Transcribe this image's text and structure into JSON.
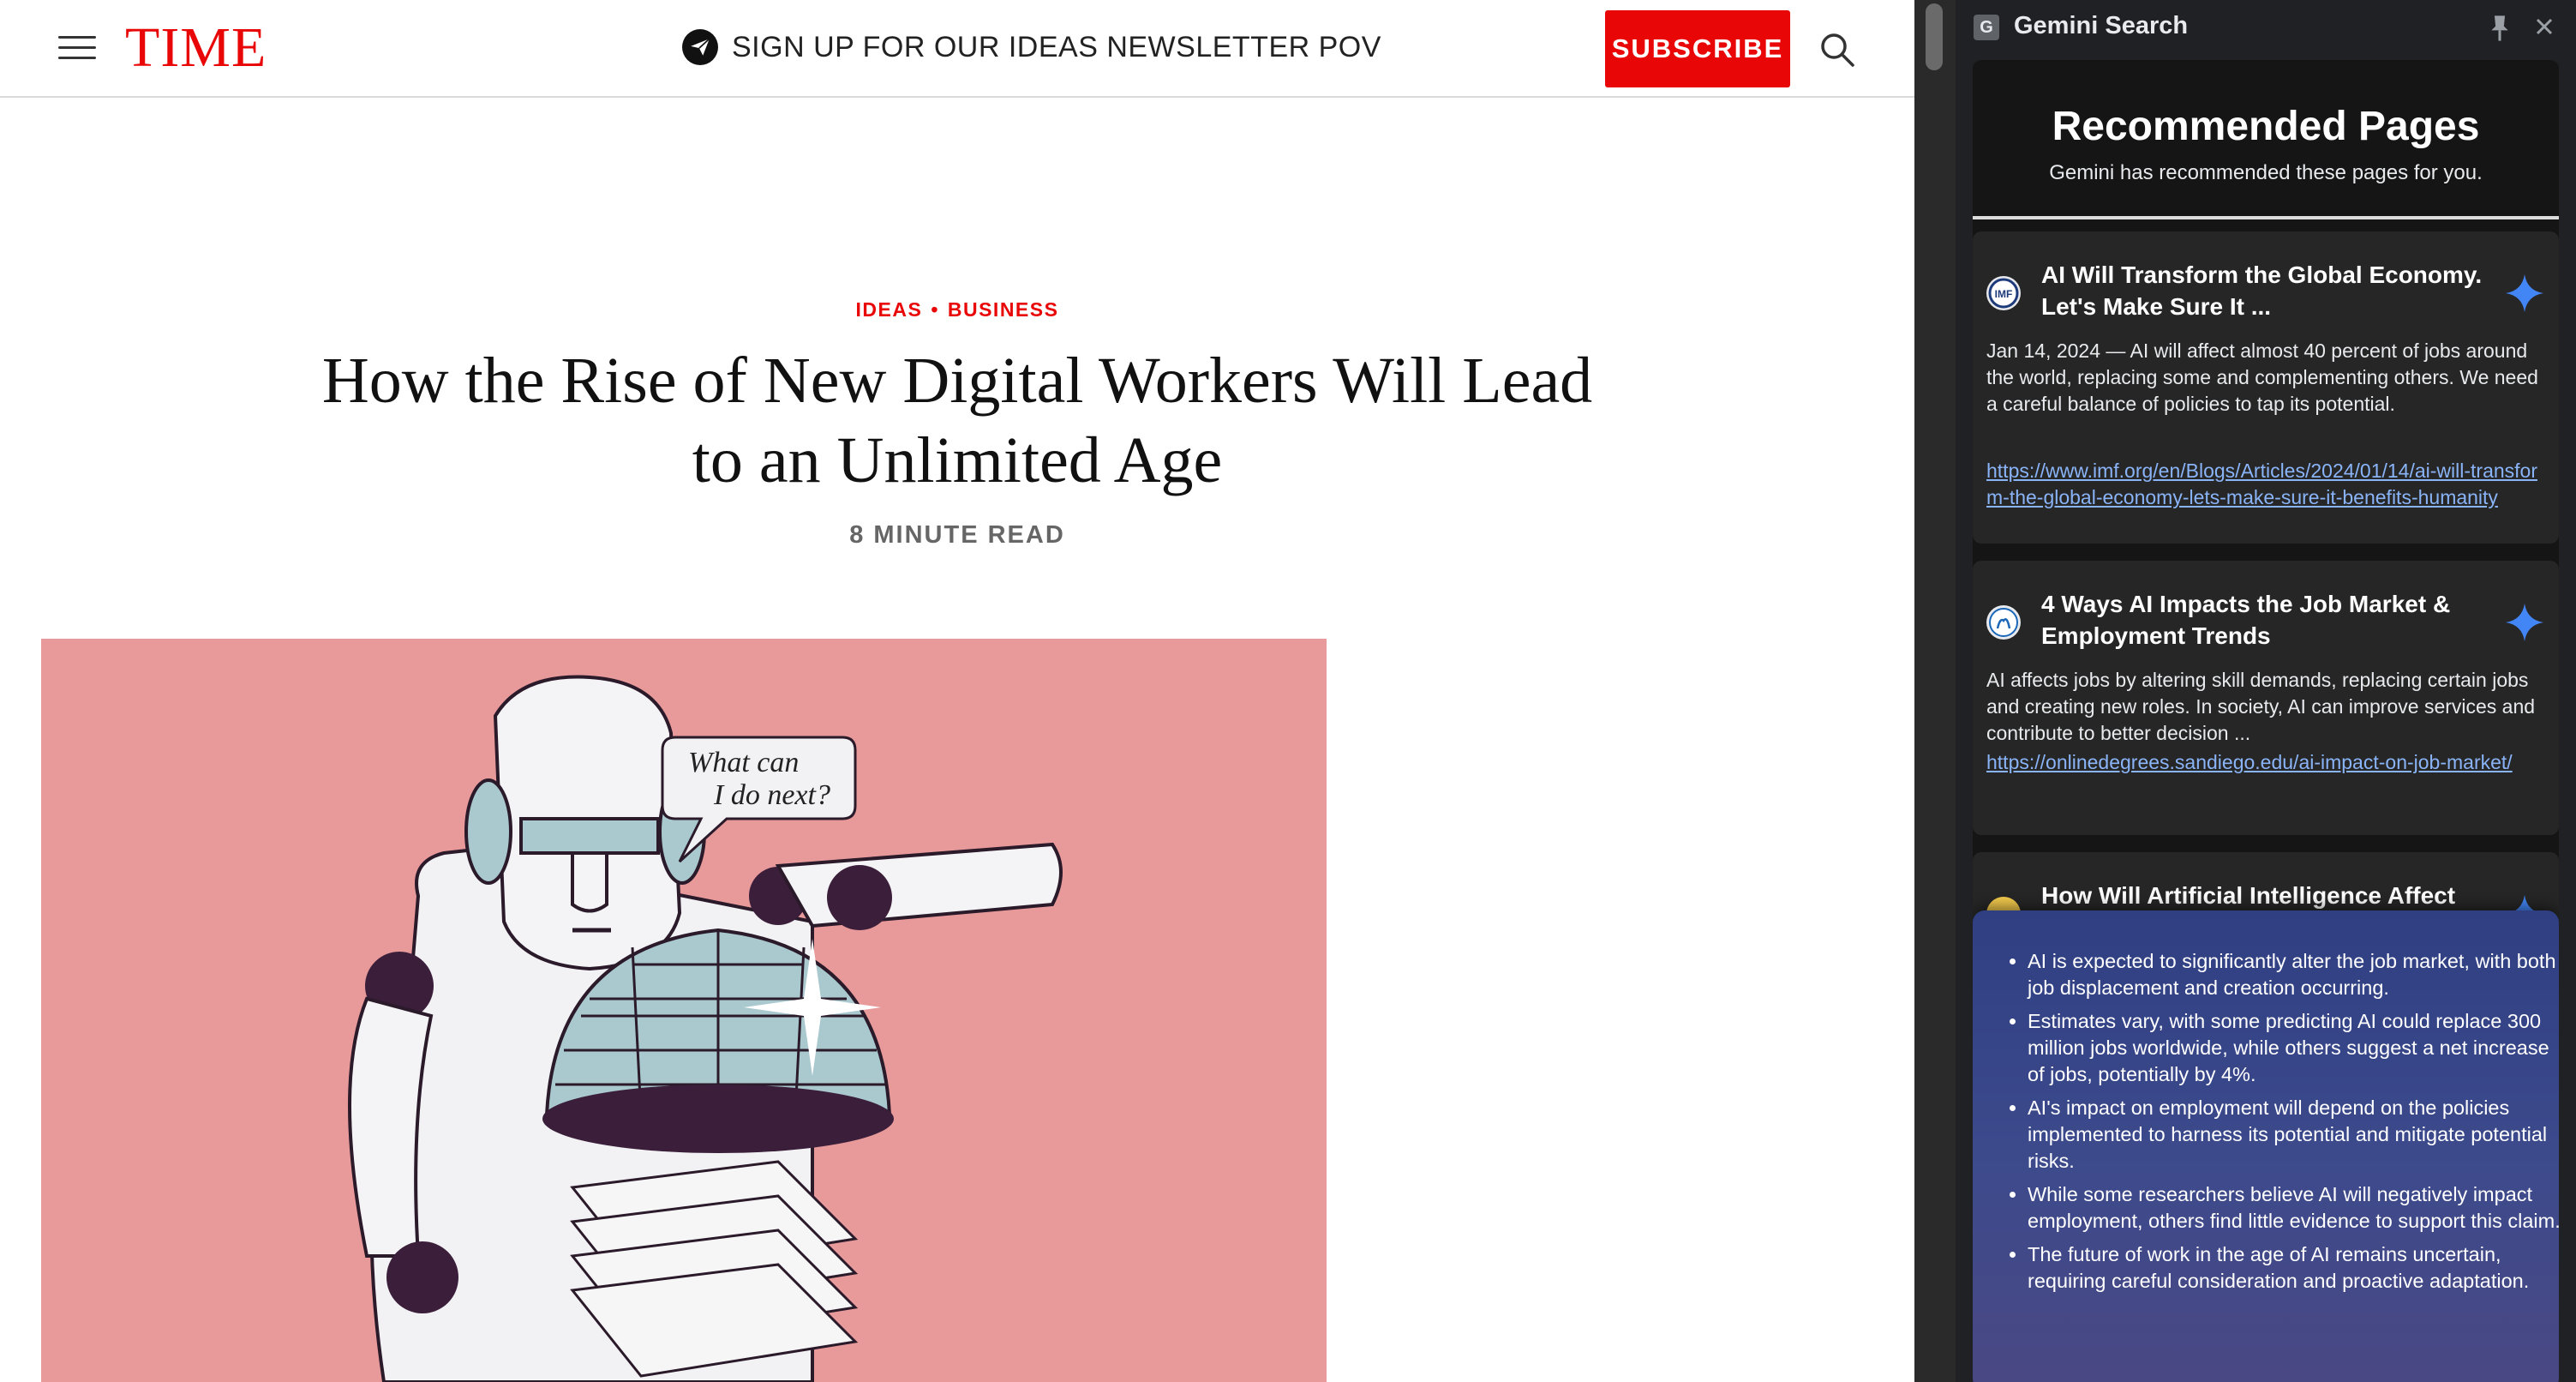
{
  "article": {
    "logo": "TIME",
    "newsletter_text": "SIGN UP FOR OUR IDEAS NEWSLETTER POV",
    "subscribe_label": "SUBSCRIBE",
    "kicker_primary": "IDEAS",
    "kicker_separator": "•",
    "kicker_secondary": "BUSINESS",
    "headline_line1": "How the Rise of New Digital Workers Will Lead",
    "headline_line2": "to an Unlimited Age",
    "read_time": "8 MINUTE READ",
    "hero_speech": [
      "What can",
      "I do next?"
    ]
  },
  "panel": {
    "badge": "G",
    "title": "Gemini Search",
    "heading": "Recommended Pages",
    "subheading": "Gemini has recommended these pages for you.",
    "cards": [
      {
        "title": "AI Will Transform the Global Economy. Let's Make Sure It ...",
        "description": "Jan 14, 2024 — AI will affect almost 40 percent of jobs around the world, replacing some and complementing others. We need a careful balance of policies to tap its potential.",
        "link": "https://www.imf.org/en/Blogs/Articles/2024/01/14/ai-will-transform-the-global-economy-lets-make-sure-it-benefits-humanity"
      },
      {
        "title": "4 Ways AI Impacts the Job Market & Employment Trends",
        "description": "AI affects jobs by altering skill demands, replacing certain jobs and creating new roles. In society, AI can improve services and contribute to better decision ...",
        "link": "https://onlinedegrees.sandiego.edu/ai-impact-on-job-market/"
      },
      {
        "title": "How Will Artificial Intelligence Affect"
      }
    ],
    "summary": [
      "AI is expected to significantly alter the job market, with both job displacement and creation occurring.",
      "Estimates vary, with some predicting AI could replace 300 million jobs worldwide, while others suggest a net increase of jobs, potentially by 4%.",
      "AI's impact on employment will depend on the policies implemented to harness its potential and mitigate potential risks.",
      "While some researchers believe AI will negatively impact employment, others find little evidence to support this claim.",
      "The future of work in the age of AI remains uncertain, requiring careful consideration and proactive adaptation."
    ]
  },
  "colors": {
    "time_red": "#e90606",
    "link_blue": "#8ab4f8",
    "sparkle_blue": "#4285f4",
    "hero_pink": "#e89a9a",
    "panel_bg": "#202124",
    "summary_bg": "#3c4a8c"
  },
  "icons": {
    "menu": "hamburger-icon",
    "newsletter": "paper-plane-icon",
    "search": "search-icon",
    "pin": "pin-icon",
    "sparkle": "gemini-sparkle-icon"
  }
}
